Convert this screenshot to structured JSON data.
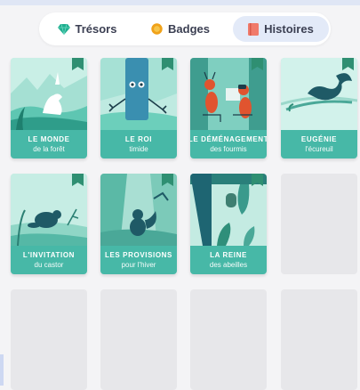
{
  "tabs": [
    {
      "label": "Trésors",
      "icon": "gem-icon",
      "active": false
    },
    {
      "label": "Badges",
      "icon": "coin-badge-icon",
      "active": false
    },
    {
      "label": "Histoires",
      "icon": "book-icon",
      "active": true
    }
  ],
  "stories": [
    {
      "title": "LE MONDE",
      "subtitle": "de la forêt"
    },
    {
      "title": "LE ROI",
      "subtitle": "timide"
    },
    {
      "title": "LE DÉMÉNAGEMENT",
      "subtitle": "des fourmis"
    },
    {
      "title": "EUGÉNIE",
      "subtitle": "l'écureuil"
    },
    {
      "title": "L'INVITATION",
      "subtitle": "du castor"
    },
    {
      "title": "LES PROVISIONS",
      "subtitle": "pour l'hiver"
    },
    {
      "title": "LA REINE",
      "subtitle": "des abeilles"
    }
  ],
  "colors": {
    "card_band": "#47b8a7",
    "card_bg": "#b8e8df",
    "bookmark": "#2f8f72",
    "active_tab": "#e3eaf8",
    "empty_slot": "#e7e7ea"
  }
}
